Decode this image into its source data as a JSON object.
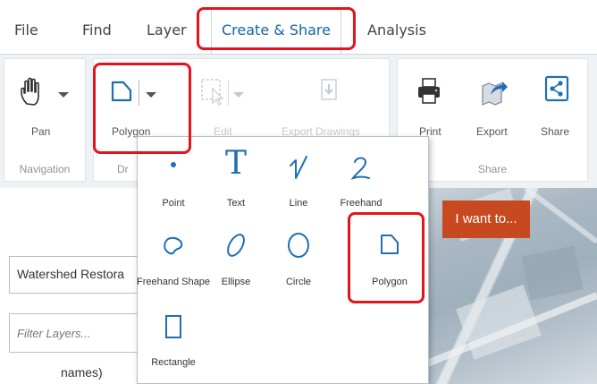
{
  "tabs": [
    "File",
    "Find",
    "Layer",
    "Create & Share",
    "Analysis"
  ],
  "active_tab_index": 3,
  "ribbon": {
    "pan_label": "Pan",
    "polygon_label": "Polygon",
    "edit_label": "Edit",
    "export_drawings_label": "Export Drawings",
    "print_label": "Print",
    "export_label": "Export",
    "share_label": "Share",
    "group_navigation": "Navigation",
    "group_draw": "Dr",
    "group_share": "Share"
  },
  "draw_menu": {
    "items": [
      "Point",
      "Text",
      "Line",
      "Freehand",
      "Freehand Shape",
      "Ellipse",
      "Circle",
      "Polygon",
      "Rectangle"
    ],
    "text_glyph": "T"
  },
  "left_panel": {
    "layer_select_value": "Watershed Restora",
    "filter_placeholder": "Filter Layers...",
    "names_text": "names)"
  },
  "map": {
    "i_want_to": "I want to..."
  },
  "colors": {
    "accent_blue": "#1565a6",
    "highlight_red": "#e4141e",
    "iwant_orange": "#c6491f"
  }
}
